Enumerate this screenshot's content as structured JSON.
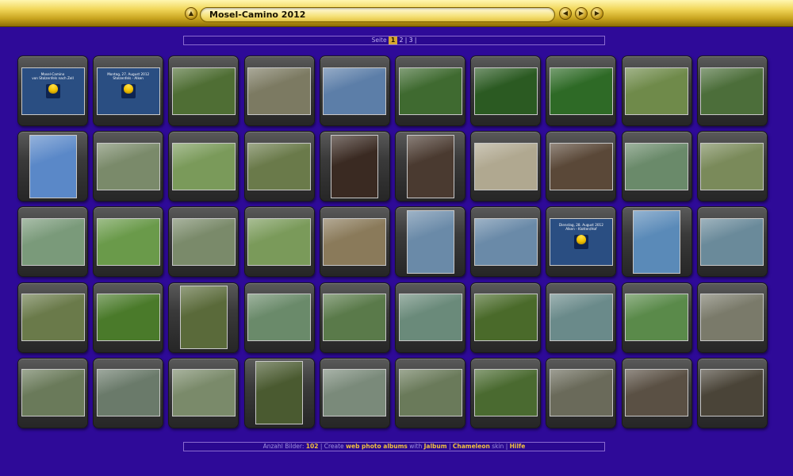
{
  "header": {
    "title": "Mosel-Camino 2012",
    "icons": [
      "home-icon",
      "prev-icon",
      "play-icon",
      "next-icon"
    ]
  },
  "pager": {
    "label": "Seite",
    "current": "1",
    "page2": "2",
    "page3": "3"
  },
  "cards": [
    {
      "line1": "Mosel-Camino",
      "line2": "von Stolzenfels nach Zell"
    },
    {
      "line1": "Montag, 27. August 2012",
      "line2": "Stolzenfels - Alken"
    },
    {
      "line1": "Dienstag, 28. August 2012",
      "line2": "Alken - Klotten/Hof"
    }
  ],
  "thumbnail_fills": [
    "#2a4e82",
    "#2a4e82",
    "#4f6e34",
    "#7c7a62",
    "#5c7ea8",
    "#3f6a30",
    "#2b5a22",
    "#2e6a26",
    "#6f8a4a",
    "#4c6e3a",
    "#5a88c8",
    "#7a8a6a",
    "#7a9a5a",
    "#6a7a4a",
    "#3a2a22",
    "#4a3a30",
    "#b0a890",
    "#5a4838",
    "#6a8a6a",
    "#7a8a5a",
    "#7a9a7a",
    "#6a9a4a",
    "#7a8a6a",
    "#7a9a5a",
    "#8a7a5a",
    "#6a8aa8",
    "#6a8aa8",
    "#2a4e82",
    "#5a8ab8",
    "#6a8a9a",
    "#6a7a4a",
    "#4a7a2a",
    "#5a6a3a",
    "#6a8a6a",
    "#5a7a4a",
    "#6a8a7a",
    "#4a6a2a",
    "#6a8a8a",
    "#5a8a4a",
    "#7a7a6a",
    "#6a7a5a",
    "#6a7a6a",
    "#7a8a6a",
    "#4a5a30",
    "#7a8a7a",
    "#6a7a5a",
    "#4a6a30",
    "#6a6a5a",
    "#5a5044",
    "#4a4438"
  ],
  "footer": {
    "count_label": "Anzahl Bilder:",
    "count": "102",
    "create": "Create",
    "link1": "web photo albums",
    "with": "with",
    "link2": "Jalbum",
    "skin_link": "Chameleon",
    "skin": "skin",
    "help": "Hilfe"
  }
}
